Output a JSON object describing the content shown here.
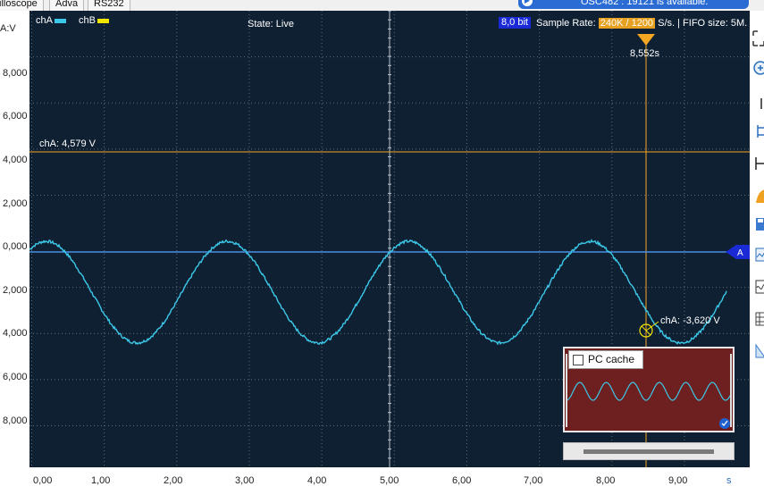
{
  "tabs": [
    {
      "label": "illoscope"
    },
    {
      "label": "Adva"
    },
    {
      "label": "RS232"
    }
  ],
  "notice": {
    "text": "OSC482 : 19121 is available."
  },
  "header": {
    "chA_label": "chA",
    "chB_label": "chB",
    "state": "State: Live",
    "bits": "8,0 bit",
    "sample_rate_prefix": "Sample Rate:",
    "sample_rate_value": "240K / 1200",
    "sample_rate_suffix": "S/s. | FIFO size: 5M."
  },
  "y_axis": {
    "unit_label": "A:V",
    "ticks": [
      "8,000",
      "6,000",
      "4,000",
      "2,000",
      "0,000",
      "2,000",
      "4,000",
      "6,000",
      "8,000"
    ]
  },
  "x_axis": {
    "ticks": [
      "0,00",
      "1,00",
      "2,00",
      "3,00",
      "4,00",
      "5,00",
      "6,00",
      "7,00",
      "8,00",
      "9,00"
    ],
    "unit": "s"
  },
  "cursors": {
    "level_label": "chA: 4,579 V",
    "time_label": "8,552s",
    "point_label": "chA: -3,620 V",
    "marker_letter": "A"
  },
  "pc_cache": {
    "label": "PC cache",
    "checked": false
  },
  "colors": {
    "plot_bg": "#0f2033",
    "chA": "#3cc8e8",
    "chB": "#f2e600",
    "cursor": "#f5a623",
    "baseline": "#4a90e2"
  },
  "chart_data": {
    "type": "line",
    "series": [
      {
        "name": "chA",
        "waveform": "sine",
        "period_s": 2.5,
        "min_v": -4.4,
        "max_v": 0.0
      }
    ],
    "xlim": [
      -0.03,
      9.9
    ],
    "ylim": [
      -9.8,
      10.0
    ],
    "grid": true
  }
}
